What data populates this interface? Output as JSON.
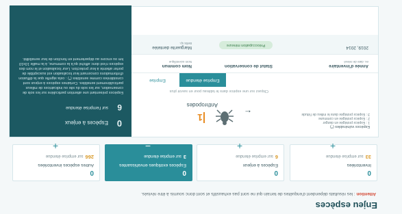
{
  "page": {
    "title": "Enjeu espèces",
    "warning_label": "Attention",
    "warning_text": " : les résultats dépendent d'enquêtes de terrain qui ne sont pas exhaustifs et sont donc soumis à être révisés."
  },
  "cards": [
    {
      "number": "0",
      "label": "Autres espèces inventoriées",
      "count": "266",
      "sub": "sur emprise étendue"
    },
    {
      "number": "0",
      "label": "Espèces exotiques envahissantes",
      "count": "3",
      "sub": "sur emprise étendue"
    },
    {
      "number": "0",
      "label": "Espèces à enjeux",
      "count": "6",
      "sub": "sur emprise étendue"
    },
    {
      "number": "0",
      "label": "Inventoriées",
      "count": "33",
      "sub": "sur emprise étendue"
    }
  ],
  "panel": {
    "legend_title": "Espèces vulnérables (*)",
    "legend_lines": [
      "1 : Espèce protégée en danger",
      "2 : Espèce protégée en commune",
      "3 : Espèce protégée dans le milieu de l'étude"
    ],
    "arrow": "←",
    "species_name": "Anthropodes",
    "species_count": "1",
    "hint": "Cliquez sur une espèce dans le tableau pour en savoir plus",
    "tabs": {
      "active": "Emprise étendue",
      "inactive": "Emprise"
    },
    "table": {
      "headers": [
        {
          "label": "Année d'inventaire",
          "sub": "ex. date de relevé"
        },
        {
          "label": "Statut de conservation",
          "sub": ""
        },
        {
          "label": "Nom commun",
          "sub": "Nom scientifique"
        }
      ],
      "row": {
        "year": "2019, 2014",
        "status": "Préoccupation mineure",
        "name": "Marguerite dentelée",
        "sub": "Bellis sp."
      }
    }
  },
  "side": {
    "big_number": "0",
    "big_label": "Espèces à enjeux",
    "mid_number": "6",
    "mid_label": "sur l'emprise étendue",
    "text": "Espèces présentant une attention particulière sur les sols de conservation, sur les sols du site ou indicatrices de milieux particulièrement sensibles. Certaines espèces à enjeux sont considérées comme sensibles (*) : cela signifie que la diffusion d'informations concernant leur localisation est susceptible de porter atteinte à leur protection. Leur localisation et le nom des espèces n'est donc affiché qu'à la commune, à la maille 10x10 km ou encore au département en fonction de leur sensibilité."
  },
  "colors": {
    "accent": "#2a8e9a",
    "side": "#1c5962",
    "warning": "#d2412c",
    "count": "#e88a1f"
  }
}
